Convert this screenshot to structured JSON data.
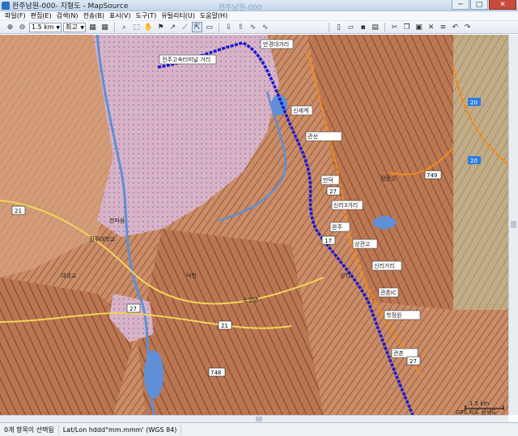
{
  "window": {
    "title": "완주남원-000- 지형도 - MapSource",
    "center_caption": "완주남원-000",
    "minimize_glyph": "─",
    "maximize_glyph": "□",
    "close_glyph": "✕"
  },
  "menubar": {
    "items": [
      "파일(F)",
      "편집(E)",
      "검색(N)",
      "전송(B)",
      "표시(V)",
      "도구(T)",
      "유틸리티(U)",
      "도움말(H)"
    ]
  },
  "toolbar": {
    "zoom_value": "1.5 km",
    "detail_value": "최고"
  },
  "map": {
    "labels": [
      "전주고속터미널 거리",
      "만경대거리",
      "신세계",
      "한마음",
      "전주대학교",
      "관선",
      "관촌IC",
      "만덕",
      "완주",
      "정문고",
      "상관고",
      "신리거리",
      "대성교",
      "덕천",
      "소양면",
      "상리",
      "관촌",
      "신리3거리",
      "학정원",
      "GPS 지도 상세도"
    ],
    "route_numbers": [
      "21",
      "27",
      "17",
      "21",
      "748",
      "749",
      "27",
      "27"
    ],
    "highway_numbers": [
      "20",
      "20"
    ],
    "scale_text": "1.5 km",
    "colors": {
      "terrain_light": "#d9a582",
      "terrain_dark": "#a8623f",
      "urban": "#d8b3c7",
      "water": "#5f8fd6",
      "route_blue": "#1a1ad0",
      "road_orange": "#f08a1c",
      "road_yellow": "#f2d35a"
    }
  },
  "status": {
    "selection": "0개 항목이 선택됨",
    "coordinates": "Lat/Lon hddd°mm.mmm' (WGS 84)"
  }
}
